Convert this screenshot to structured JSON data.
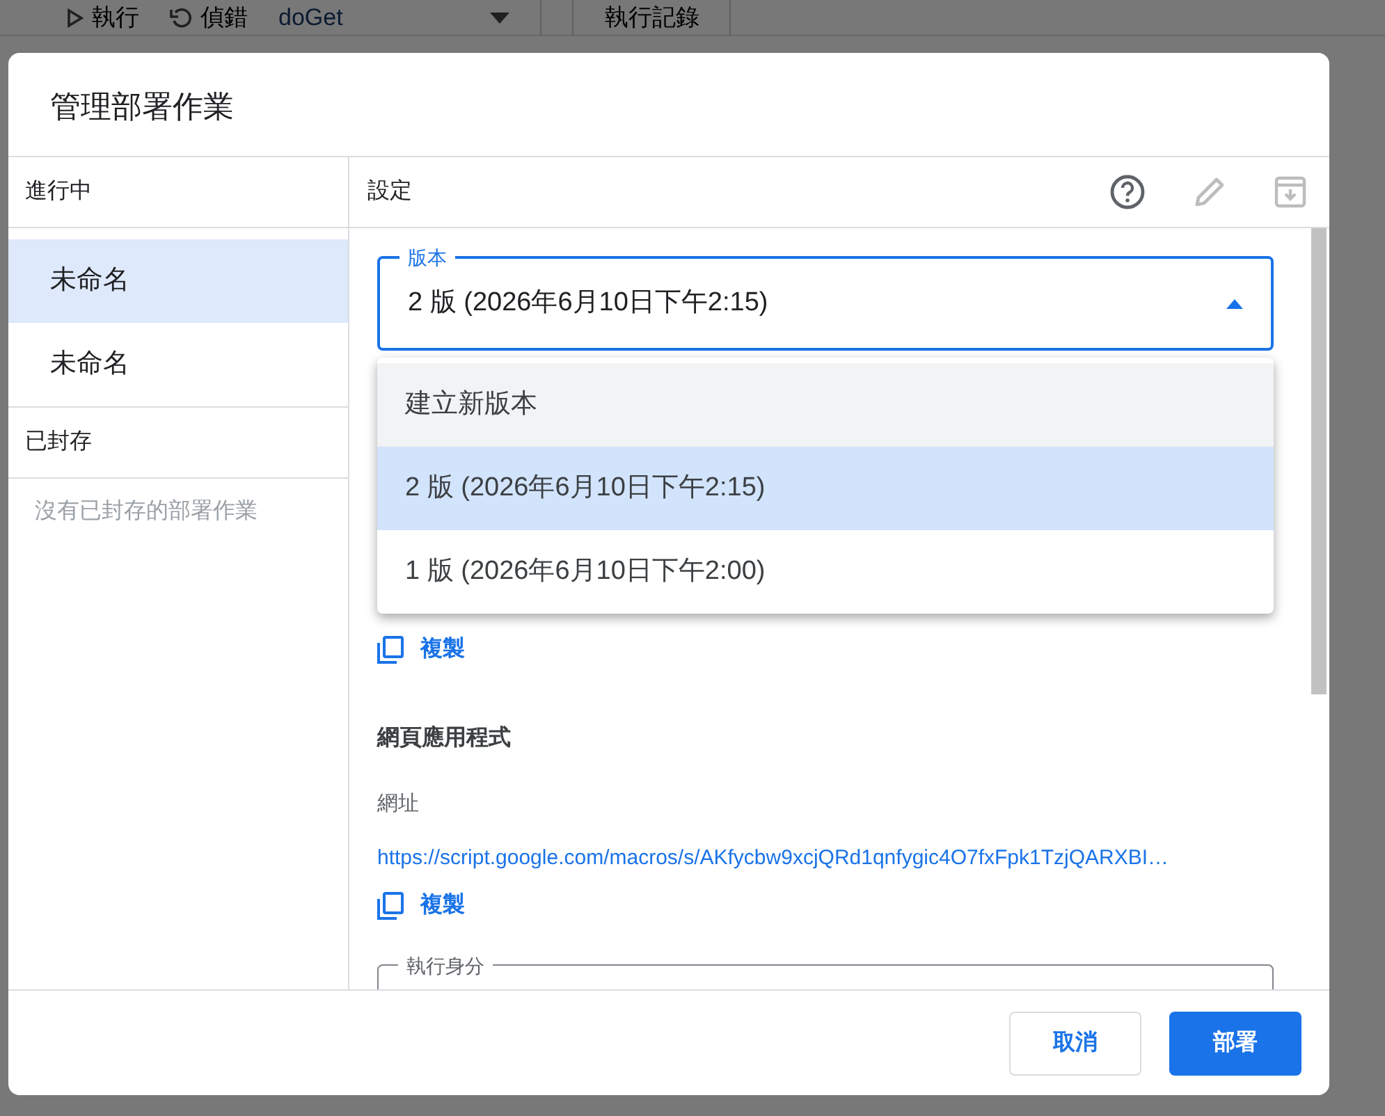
{
  "background_toolbar": [
    {
      "kind": "run",
      "label": "執行"
    },
    {
      "kind": "debug",
      "label": "偵錯"
    },
    {
      "kind": "function_select",
      "label": "doGet"
    },
    {
      "kind": "log",
      "label": "執行記錄"
    }
  ],
  "dialog": {
    "title": "管理部署作業",
    "sidebar": [
      {
        "heading": "進行中",
        "items": [
          {
            "label": "未命名",
            "selected": true
          },
          {
            "label": "未命名",
            "selected": false
          }
        ]
      },
      {
        "heading": "已封存",
        "empty_text": "沒有已封存的部署作業"
      }
    ],
    "settings": {
      "heading": "設定",
      "version_field": {
        "label": "版本",
        "value": "2 版 (2026年6月10日下午2:15)",
        "expanded": true
      },
      "version_menu": [
        {
          "label": "建立新版本",
          "selected": false,
          "hovered": true
        },
        {
          "label": "2 版 (2026年6月10日下午2:15)",
          "selected": true,
          "hovered": false
        },
        {
          "label": "1 版 (2026年6月10日下午2:00)",
          "selected": false,
          "hovered": false
        }
      ],
      "copy_deployment": "複製",
      "section_title": "網頁應用程式",
      "url_label": "網址",
      "url": "https://script.google.com/macros/s/AKfycbw9xcjQRd1qnfygic4O7fxFpk1TzjQARXBI…",
      "copy_url": "複製",
      "execute_as_label": "執行身分"
    },
    "buttons": [
      {
        "kind": "secondary",
        "label": "取消"
      },
      {
        "kind": "primary",
        "label": "部署"
      }
    ]
  }
}
